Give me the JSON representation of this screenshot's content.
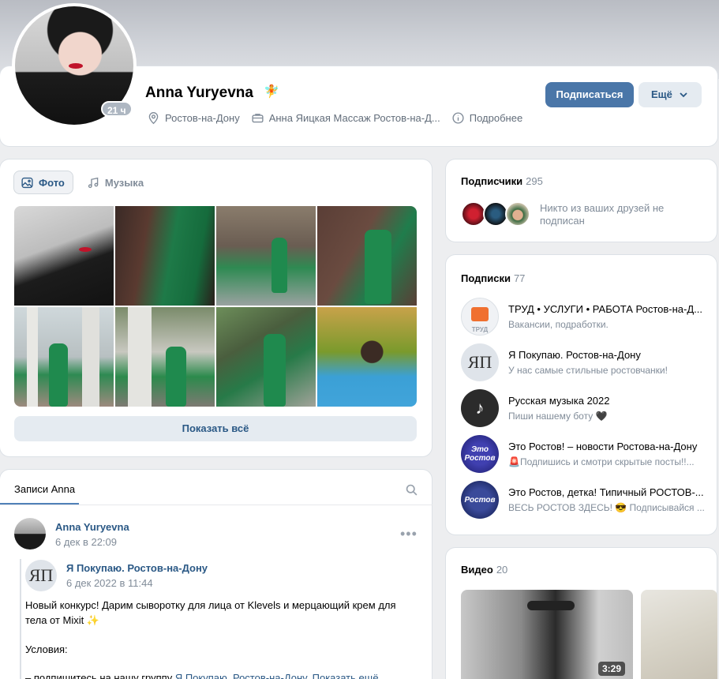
{
  "profile": {
    "name": "Anna Yuryevna",
    "name_emoji": "🧚",
    "age_badge": "21 ч",
    "city": "Ростов-на-Дону",
    "work": "Анна Яицкая Массаж Ростов-на-Д...",
    "more_info": "Подробнее",
    "subscribe_label": "Подписаться",
    "more_label": "Ещё"
  },
  "media": {
    "tabs": [
      {
        "label": "Фото",
        "icon": "photo-icon",
        "active": true
      },
      {
        "label": "Музыка",
        "icon": "music-note-icon",
        "active": false
      }
    ],
    "show_all_label": "Показать всё"
  },
  "wall": {
    "tab_label": "Записи Anna",
    "post": {
      "author": "Anna Yuryevna",
      "date": "6 дек в 22:09",
      "repost": {
        "author": "Я Покупаю. Ростов-на-Дону",
        "avatar_text": "ЯП",
        "date": "6 дек 2022 в 11:44",
        "text": "Новый конкурс! Дарим сыворотку для лица от Klevels и мерцающий крем для тела от Mixit ✨",
        "conditions": "Условия:",
        "line3_prefix": "– подпишитесь на нашу группу ",
        "line3_link": "Я Покупаю. Ростов-на-Дону",
        "line3_more": "Показать ещё"
      }
    }
  },
  "followers": {
    "title": "Подписчики",
    "count": "295",
    "no_friends_text": "Никто из ваших друзей не подписан"
  },
  "subscriptions": {
    "title": "Подписки",
    "count": "77",
    "items": [
      {
        "name": "ТРУД • УСЛУГИ • РАБОТА Ростов-на-Д...",
        "sub": "Вакансии, подработки.",
        "avatar_text": "ТРУД",
        "color": "#f0f2f5"
      },
      {
        "name": "Я Покупаю. Ростов-на-Дону",
        "sub": "У нас самые стильные ростовчанки!",
        "avatar_text": "ЯП",
        "color": "#dfe4ea"
      },
      {
        "name": "Русская музыка 2022",
        "sub": "Пиши нашему боту 🖤",
        "avatar_text": "",
        "color": "#2b2b2b"
      },
      {
        "name": "Это Ростов! – новости Ростова-на-Дону",
        "sub": "🚨Подпишись и смотри скрытые посты!!...",
        "avatar_text": "Это Ростов",
        "color": "#2a2a8c"
      },
      {
        "name": "Это Ростов, детка! Типичный РОСТОВ-...",
        "sub": "ВЕСЬ РОСТОВ ЗДЕСЬ! 😎 Подписывайся ...",
        "avatar_text": "Ростов",
        "color": "#1d2a6b"
      }
    ]
  },
  "videos": {
    "title": "Видео",
    "count": "20",
    "items": [
      {
        "duration": "3:29"
      }
    ]
  }
}
